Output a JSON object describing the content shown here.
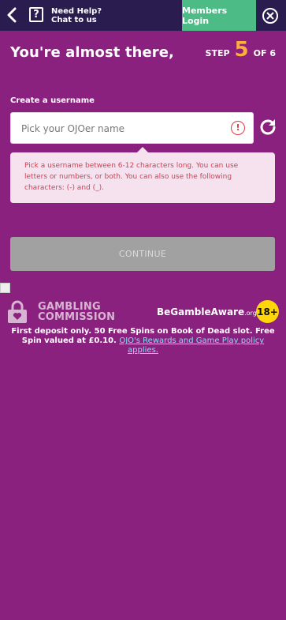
{
  "header": {
    "help_line1": "Need Help?",
    "help_line2": "Chat to us",
    "help_icon_glyph": "?",
    "members_login": "Members Login"
  },
  "page": {
    "title": "You're almost there,",
    "step_label": "STEP",
    "step_number": "5",
    "step_total": "OF 6"
  },
  "form": {
    "username_label": "Create a username",
    "username_placeholder": "Pick your OJOer name",
    "username_value": "",
    "warning_glyph": "!",
    "hint": "Pick a username between 6-12 characters long. You can use letters or numbers, or both. You can also use the following characters: (-) and (_).",
    "continue_label": "CONTINUE"
  },
  "footer": {
    "gambling_commission_line1": "GAMBLING",
    "gambling_commission_line2": "COMMISSION",
    "begambleaware": "BeGambleAware",
    "begambleaware_org": ".org",
    "begambleaware_reg": "®",
    "age_badge": "18+",
    "terms_text": "First deposit only. 50 Free Spins on Book of Dead slot. Free Spin valued at £0.10.",
    "terms_link": "OJO's Rewards and Game Play policy applies."
  },
  "colors": {
    "background": "#8b217f",
    "topbar": "#2b1c4f",
    "members_button": "#4dbb86",
    "step_accent": "#ffae3b",
    "error": "#d5404e",
    "disabled_button": "#a1a1a1",
    "age_badge": "#ffd60a",
    "link": "#7fe0f0"
  },
  "icons": {
    "back": "chevron-left-icon",
    "help": "question-box-icon",
    "close": "close-circle-icon",
    "warning": "warning-circle-icon",
    "refresh": "refresh-icon",
    "gambling_commission": "padlock-heart-icon"
  }
}
